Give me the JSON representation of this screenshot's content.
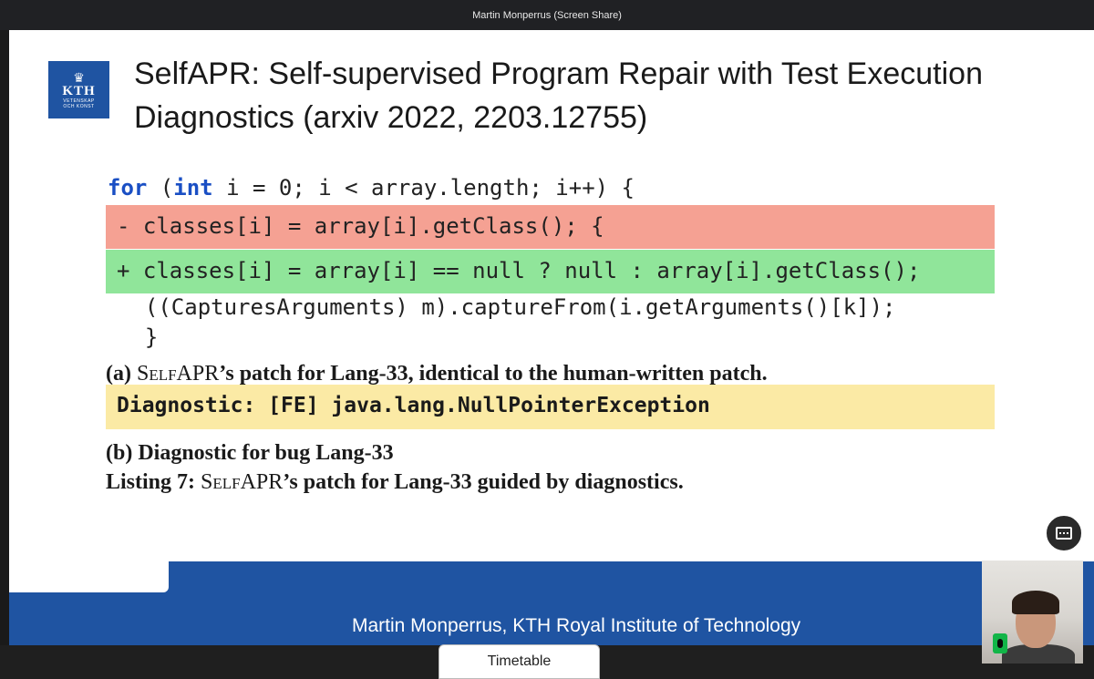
{
  "app": {
    "title": "Martin Monperrus (Screen Share)"
  },
  "slide": {
    "logo": {
      "text": "KTH",
      "subtext_1": "VETENSKAP",
      "subtext_2": "OCH KONST"
    },
    "title": "SelfAPR: Self-supervised Program Repair with Test Execution Diagnostics (arxiv 2022, 2203.12755)",
    "code": {
      "line1_kw1": "for",
      "line1_mid": " (",
      "line1_kw2": "int",
      "line1_rest": " i = 0; i < array.length; i++) {",
      "removed_line": "- classes[i] = array[i].getClass(); {",
      "added_line": "+ classes[i] = array[i] == null ? null : array[i].getClass();",
      "line4": "  ((CapturesArguments) m).captureFrom(i.getArguments()[k]);",
      "line5": "  }"
    },
    "caption_a": {
      "prefix": "(a) ",
      "name": "SelfAPR",
      "rest": "’s patch for Lang-33, identical to the human-written patch."
    },
    "diagnostic": "Diagnostic: [FE] java.lang.NullPointerException",
    "caption_b": "(b) Diagnostic for bug Lang-33",
    "listing": {
      "prefix": "Listing 7: ",
      "name": "SelfAPR",
      "rest": "’s patch for Lang-33 guided by diagnostics."
    },
    "footer": "Martin Monperrus, KTH Royal Institute of Technology"
  },
  "bottom": {
    "timetable_label": "Timetable"
  },
  "icons": {
    "present": "presentation-screen-icon",
    "mic": "microphone-on-icon"
  },
  "colors": {
    "removed": "#f5a193",
    "added": "#90e59a",
    "diagnostic": "#fbeaa5",
    "kth_blue": "#1f54a2",
    "keyword": "#1a4fc4"
  }
}
